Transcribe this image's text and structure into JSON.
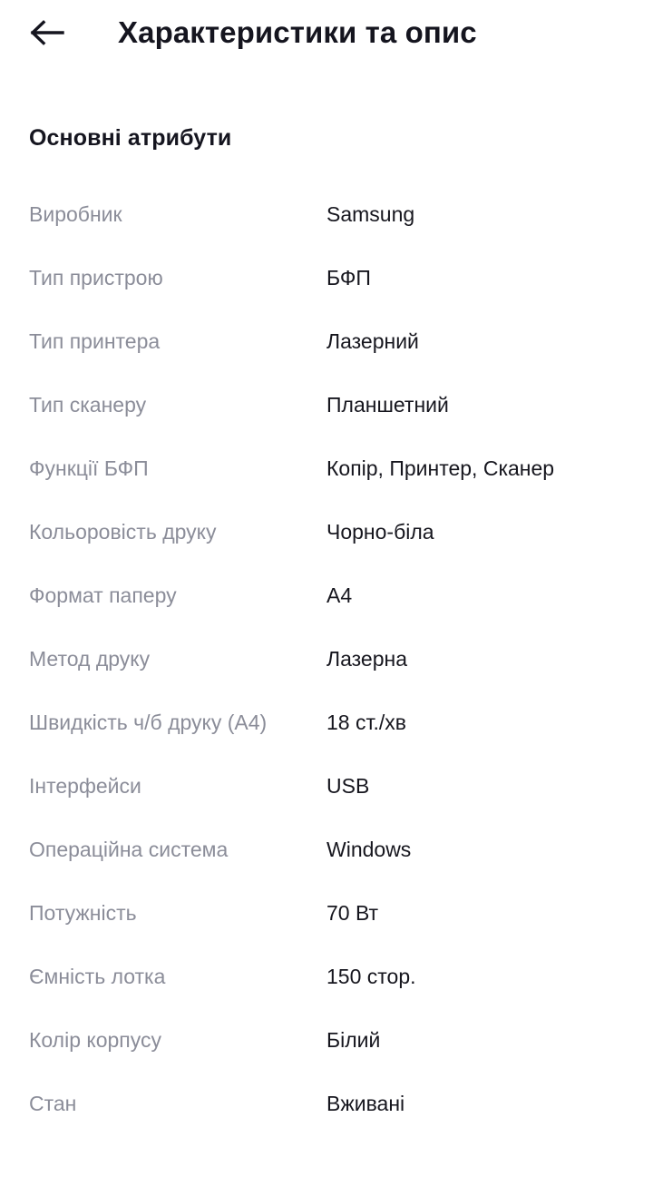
{
  "header": {
    "back_icon": "arrow-left-icon",
    "title": "Характеристики та опис"
  },
  "section": {
    "title": "Основні атрибути"
  },
  "attributes": [
    {
      "label": "Виробник",
      "value": "Samsung"
    },
    {
      "label": "Тип пристрою",
      "value": "БФП"
    },
    {
      "label": "Тип принтера",
      "value": "Лазерний"
    },
    {
      "label": "Тип сканеру",
      "value": "Планшетний"
    },
    {
      "label": "Функції БФП",
      "value": "Копір, Принтер, Сканер"
    },
    {
      "label": "Кольоровість друку",
      "value": "Чорно-біла"
    },
    {
      "label": "Формат паперу",
      "value": "A4"
    },
    {
      "label": "Метод друку",
      "value": "Лазерна"
    },
    {
      "label": "Швидкість ч/б друку (A4)",
      "value": "18 ст./хв"
    },
    {
      "label": "Інтерфейси",
      "value": "USB"
    },
    {
      "label": "Операційна система",
      "value": "Windows"
    },
    {
      "label": "Потужність",
      "value": "70 Вт"
    },
    {
      "label": "Ємність лотка",
      "value": "150 стор."
    },
    {
      "label": "Колір корпусу",
      "value": "Білий"
    },
    {
      "label": "Стан",
      "value": "Вживані"
    }
  ],
  "colors": {
    "background": "#ffffff",
    "heading": "#15151f",
    "label": "#8b8d99",
    "value": "#16161e"
  }
}
